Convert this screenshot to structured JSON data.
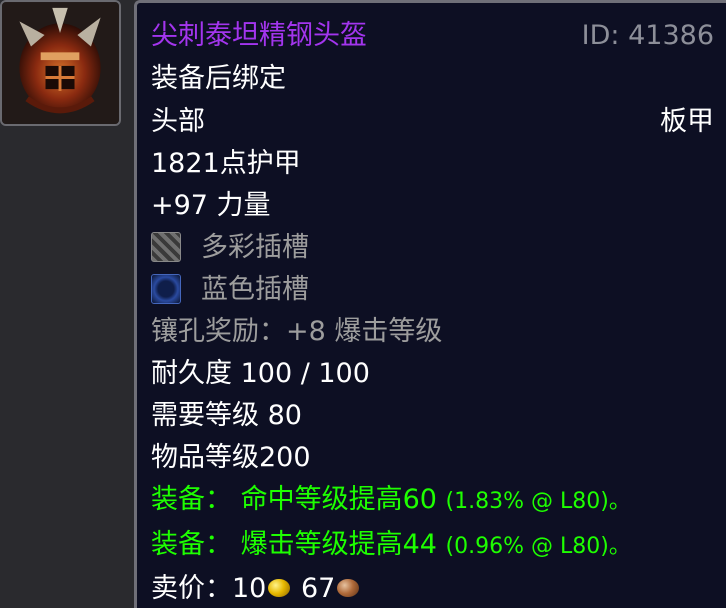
{
  "icon": {
    "name": "spiked-helmet-icon"
  },
  "tooltip": {
    "title": "尖刺泰坦精钢头盔",
    "item_id": "ID: 41386",
    "binding": "装备后绑定",
    "slot": "头部",
    "armor_type": "板甲",
    "armor": "1821点护甲",
    "stat": "+97 力量",
    "sockets": [
      {
        "icon": "prismatic-socket-icon",
        "label": "多彩插槽"
      },
      {
        "icon": "blue-socket-icon",
        "label": "蓝色插槽"
      }
    ],
    "socket_bonus": "镶孔奖励：+8 爆击等级",
    "durability": "耐久度 100 / 100",
    "required_level": "需要等级 80",
    "item_level": "物品等级200",
    "equip_effects": [
      {
        "text": "装备： 命中等级提高60",
        "pct": "(1.83% @ L80)。"
      },
      {
        "text": "装备： 爆击等级提高44",
        "pct": "(0.96% @ L80)。"
      }
    ],
    "sell_price": {
      "label": "卖价：",
      "gold": "10",
      "silver": "67"
    }
  },
  "colors": {
    "epic": "#a335ee",
    "uncommon": "#1eff00",
    "gray": "#9d9d9d",
    "background": "#0d0f23"
  }
}
